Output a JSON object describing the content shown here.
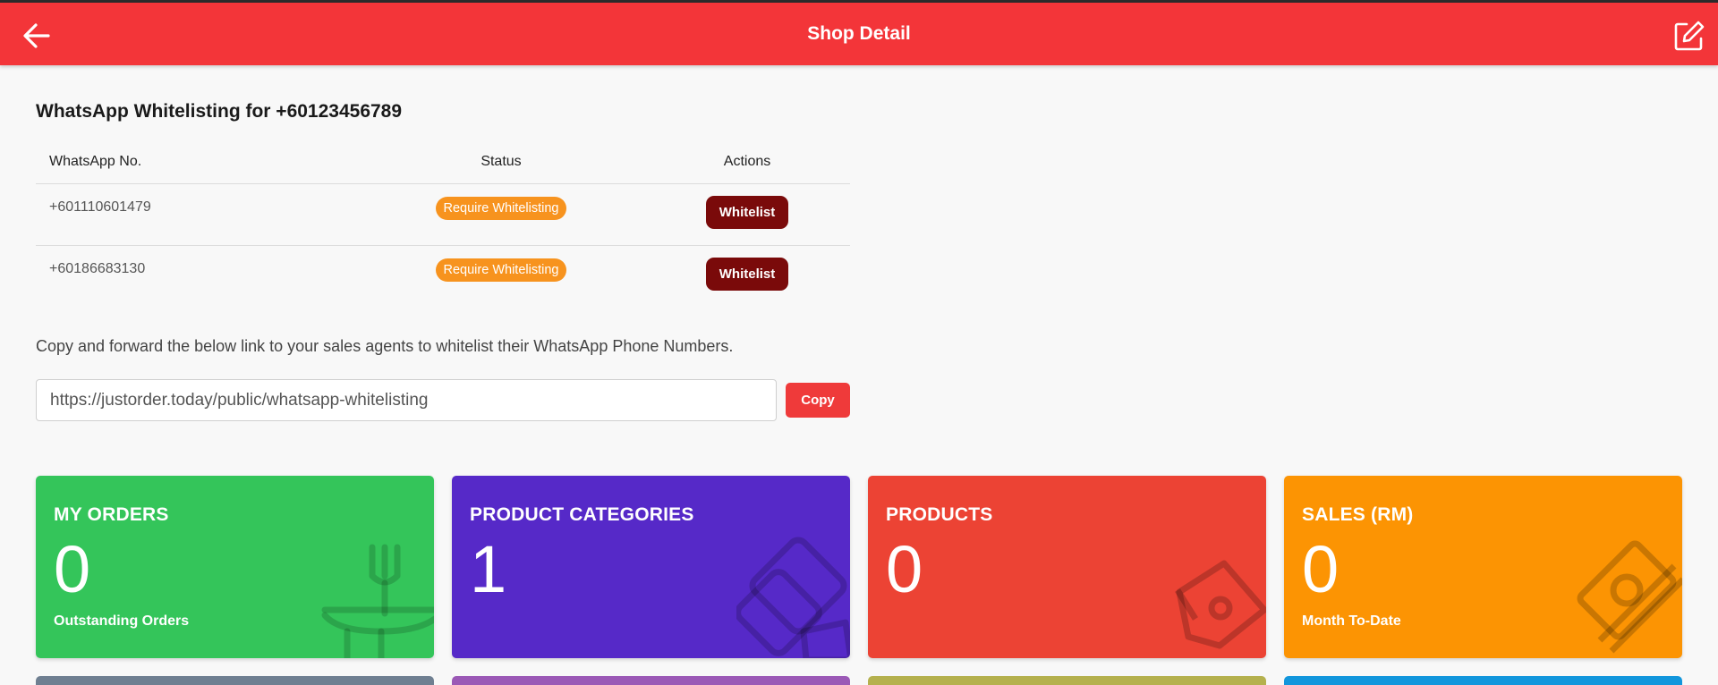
{
  "header": {
    "title": "Shop Detail",
    "back_icon": "back-arrow-icon",
    "edit_icon": "edit-icon",
    "background": "#f33539"
  },
  "whitelisting": {
    "title": "WhatsApp Whitelisting for +60123456789",
    "columns": [
      "WhatsApp No.",
      "Status",
      "Actions"
    ],
    "rows": [
      {
        "number": "+601110601479",
        "status": "Require Whitelisting",
        "action": "Whitelist"
      },
      {
        "number": "+60186683130",
        "status": "Require Whitelisting",
        "action": "Whitelist"
      }
    ]
  },
  "share": {
    "instructions": "Copy and forward the below link to your sales agents to whitelist their WhatsApp Phone Numbers.",
    "link": "https://justorder.today/public/whatsapp-whitelisting",
    "copy_label": "Copy"
  },
  "cards": [
    {
      "title": "MY ORDERS",
      "value": "0",
      "subtitle": "Outstanding Orders",
      "color": "#34c55a",
      "icon": "dining-icon"
    },
    {
      "title": "PRODUCT CATEGORIES",
      "value": "1",
      "subtitle": "",
      "color": "#5629c8",
      "icon": "categories-icon"
    },
    {
      "title": "PRODUCTS",
      "value": "0",
      "subtitle": "",
      "color": "#ec4334",
      "icon": "price-tag-icon"
    },
    {
      "title": "SALES (RM)",
      "value": "0",
      "subtitle": "Month To-Date",
      "color": "#fc9403",
      "icon": "money-icon"
    }
  ],
  "lower_cards_colors": [
    "#6f7f91",
    "#9b59b6",
    "#b5b14e",
    "#1296dc"
  ]
}
